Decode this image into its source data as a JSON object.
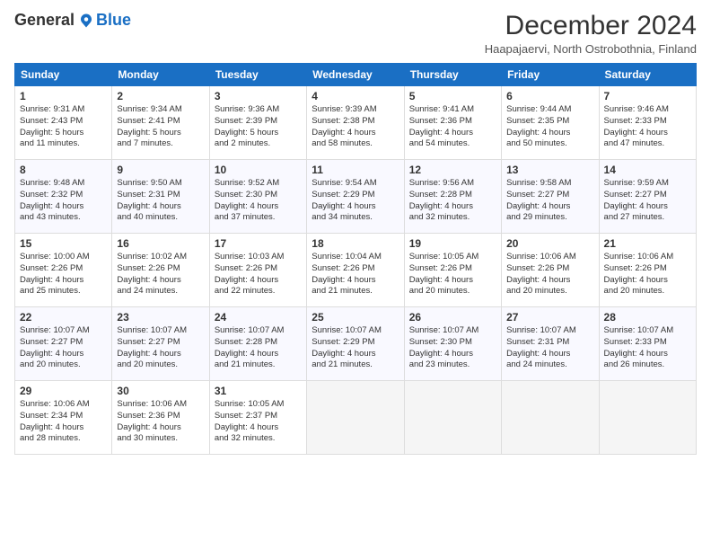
{
  "logo": {
    "general": "General",
    "blue": "Blue"
  },
  "title": "December 2024",
  "subtitle": "Haapajaervi, North Ostrobothnia, Finland",
  "days": [
    "Sunday",
    "Monday",
    "Tuesday",
    "Wednesday",
    "Thursday",
    "Friday",
    "Saturday"
  ],
  "weeks": [
    [
      {
        "num": "1",
        "lines": [
          "Sunrise: 9:31 AM",
          "Sunset: 2:43 PM",
          "Daylight: 5 hours",
          "and 11 minutes."
        ]
      },
      {
        "num": "2",
        "lines": [
          "Sunrise: 9:34 AM",
          "Sunset: 2:41 PM",
          "Daylight: 5 hours",
          "and 7 minutes."
        ]
      },
      {
        "num": "3",
        "lines": [
          "Sunrise: 9:36 AM",
          "Sunset: 2:39 PM",
          "Daylight: 5 hours",
          "and 2 minutes."
        ]
      },
      {
        "num": "4",
        "lines": [
          "Sunrise: 9:39 AM",
          "Sunset: 2:38 PM",
          "Daylight: 4 hours",
          "and 58 minutes."
        ]
      },
      {
        "num": "5",
        "lines": [
          "Sunrise: 9:41 AM",
          "Sunset: 2:36 PM",
          "Daylight: 4 hours",
          "and 54 minutes."
        ]
      },
      {
        "num": "6",
        "lines": [
          "Sunrise: 9:44 AM",
          "Sunset: 2:35 PM",
          "Daylight: 4 hours",
          "and 50 minutes."
        ]
      },
      {
        "num": "7",
        "lines": [
          "Sunrise: 9:46 AM",
          "Sunset: 2:33 PM",
          "Daylight: 4 hours",
          "and 47 minutes."
        ]
      }
    ],
    [
      {
        "num": "8",
        "lines": [
          "Sunrise: 9:48 AM",
          "Sunset: 2:32 PM",
          "Daylight: 4 hours",
          "and 43 minutes."
        ]
      },
      {
        "num": "9",
        "lines": [
          "Sunrise: 9:50 AM",
          "Sunset: 2:31 PM",
          "Daylight: 4 hours",
          "and 40 minutes."
        ]
      },
      {
        "num": "10",
        "lines": [
          "Sunrise: 9:52 AM",
          "Sunset: 2:30 PM",
          "Daylight: 4 hours",
          "and 37 minutes."
        ]
      },
      {
        "num": "11",
        "lines": [
          "Sunrise: 9:54 AM",
          "Sunset: 2:29 PM",
          "Daylight: 4 hours",
          "and 34 minutes."
        ]
      },
      {
        "num": "12",
        "lines": [
          "Sunrise: 9:56 AM",
          "Sunset: 2:28 PM",
          "Daylight: 4 hours",
          "and 32 minutes."
        ]
      },
      {
        "num": "13",
        "lines": [
          "Sunrise: 9:58 AM",
          "Sunset: 2:27 PM",
          "Daylight: 4 hours",
          "and 29 minutes."
        ]
      },
      {
        "num": "14",
        "lines": [
          "Sunrise: 9:59 AM",
          "Sunset: 2:27 PM",
          "Daylight: 4 hours",
          "and 27 minutes."
        ]
      }
    ],
    [
      {
        "num": "15",
        "lines": [
          "Sunrise: 10:00 AM",
          "Sunset: 2:26 PM",
          "Daylight: 4 hours",
          "and 25 minutes."
        ]
      },
      {
        "num": "16",
        "lines": [
          "Sunrise: 10:02 AM",
          "Sunset: 2:26 PM",
          "Daylight: 4 hours",
          "and 24 minutes."
        ]
      },
      {
        "num": "17",
        "lines": [
          "Sunrise: 10:03 AM",
          "Sunset: 2:26 PM",
          "Daylight: 4 hours",
          "and 22 minutes."
        ]
      },
      {
        "num": "18",
        "lines": [
          "Sunrise: 10:04 AM",
          "Sunset: 2:26 PM",
          "Daylight: 4 hours",
          "and 21 minutes."
        ]
      },
      {
        "num": "19",
        "lines": [
          "Sunrise: 10:05 AM",
          "Sunset: 2:26 PM",
          "Daylight: 4 hours",
          "and 20 minutes."
        ]
      },
      {
        "num": "20",
        "lines": [
          "Sunrise: 10:06 AM",
          "Sunset: 2:26 PM",
          "Daylight: 4 hours",
          "and 20 minutes."
        ]
      },
      {
        "num": "21",
        "lines": [
          "Sunrise: 10:06 AM",
          "Sunset: 2:26 PM",
          "Daylight: 4 hours",
          "and 20 minutes."
        ]
      }
    ],
    [
      {
        "num": "22",
        "lines": [
          "Sunrise: 10:07 AM",
          "Sunset: 2:27 PM",
          "Daylight: 4 hours",
          "and 20 minutes."
        ]
      },
      {
        "num": "23",
        "lines": [
          "Sunrise: 10:07 AM",
          "Sunset: 2:27 PM",
          "Daylight: 4 hours",
          "and 20 minutes."
        ]
      },
      {
        "num": "24",
        "lines": [
          "Sunrise: 10:07 AM",
          "Sunset: 2:28 PM",
          "Daylight: 4 hours",
          "and 21 minutes."
        ]
      },
      {
        "num": "25",
        "lines": [
          "Sunrise: 10:07 AM",
          "Sunset: 2:29 PM",
          "Daylight: 4 hours",
          "and 21 minutes."
        ]
      },
      {
        "num": "26",
        "lines": [
          "Sunrise: 10:07 AM",
          "Sunset: 2:30 PM",
          "Daylight: 4 hours",
          "and 23 minutes."
        ]
      },
      {
        "num": "27",
        "lines": [
          "Sunrise: 10:07 AM",
          "Sunset: 2:31 PM",
          "Daylight: 4 hours",
          "and 24 minutes."
        ]
      },
      {
        "num": "28",
        "lines": [
          "Sunrise: 10:07 AM",
          "Sunset: 2:33 PM",
          "Daylight: 4 hours",
          "and 26 minutes."
        ]
      }
    ],
    [
      {
        "num": "29",
        "lines": [
          "Sunrise: 10:06 AM",
          "Sunset: 2:34 PM",
          "Daylight: 4 hours",
          "and 28 minutes."
        ]
      },
      {
        "num": "30",
        "lines": [
          "Sunrise: 10:06 AM",
          "Sunset: 2:36 PM",
          "Daylight: 4 hours",
          "and 30 minutes."
        ]
      },
      {
        "num": "31",
        "lines": [
          "Sunrise: 10:05 AM",
          "Sunset: 2:37 PM",
          "Daylight: 4 hours",
          "and 32 minutes."
        ]
      },
      null,
      null,
      null,
      null
    ]
  ]
}
